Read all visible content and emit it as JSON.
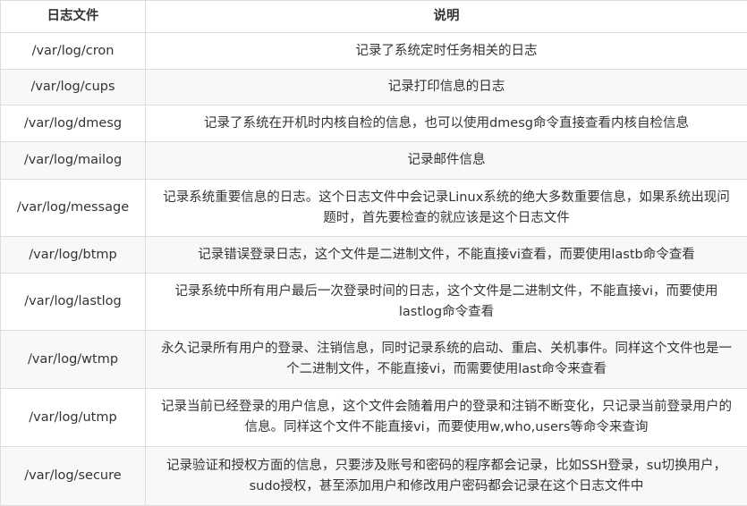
{
  "table": {
    "headers": {
      "file": "日志文件",
      "description": "说明"
    },
    "rows": [
      {
        "file": "/var/log/cron",
        "description": "记录了系统定时任务相关的日志"
      },
      {
        "file": "/var/log/cups",
        "description": "记录打印信息的日志"
      },
      {
        "file": "/var/log/dmesg",
        "description": "记录了系统在开机时内核自检的信息，也可以使用dmesg命令直接查看内核自检信息"
      },
      {
        "file": "/var/log/mailog",
        "description": "记录邮件信息"
      },
      {
        "file": "/var/log/message",
        "description": "记录系统重要信息的日志。这个日志文件中会记录Linux系统的绝大多数重要信息，如果系统出现问题时，首先要检查的就应该是这个日志文件"
      },
      {
        "file": "/var/log/btmp",
        "description": "记录错误登录日志，这个文件是二进制文件，不能直接vi查看，而要使用lastb命令查看"
      },
      {
        "file": "/var/log/lastlog",
        "description": "记录系统中所有用户最后一次登录时间的日志，这个文件是二进制文件，不能直接vi，而要使用lastlog命令查看"
      },
      {
        "file": "/var/log/wtmp",
        "description": "永久记录所有用户的登录、注销信息，同时记录系统的启动、重启、关机事件。同样这个文件也是一个二进制文件，不能直接vi，而需要使用last命令来查看"
      },
      {
        "file": "/var/log/utmp",
        "description": "记录当前已经登录的用户信息，这个文件会随着用户的登录和注销不断变化，只记录当前登录用户的信息。同样这个文件不能直接vi，而要使用w,who,users等命令来查询"
      },
      {
        "file": "/var/log/secure",
        "description": "记录验证和授权方面的信息，只要涉及账号和密码的程序都会记录，比如SSH登录，su切换用户，sudo授权，甚至添加用户和修改用户密码都会记录在这个日志文件中"
      }
    ]
  }
}
